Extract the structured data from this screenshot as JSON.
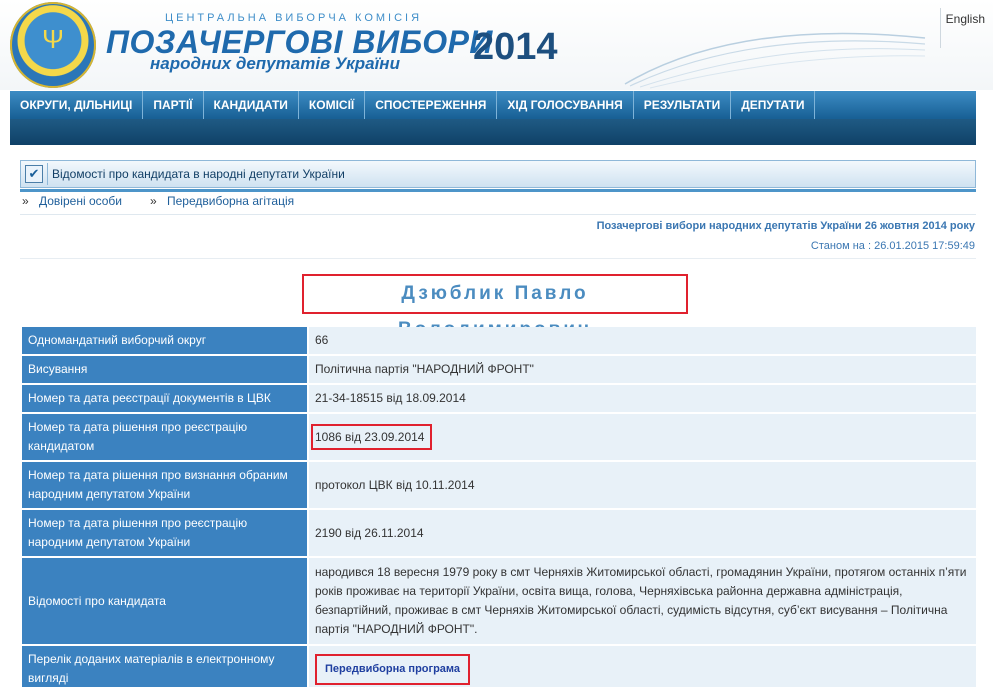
{
  "header": {
    "commission_name": "ЦЕНТРАЛЬНА ВИБОРЧА КОМІСІЯ",
    "title": "ПОЗАЧЕРГОВІ ВИБОРИ",
    "subtitle": "народних депутатів України",
    "year": "2014",
    "language_link": "English",
    "emblem_icon": "emblem-icon",
    "accent_color": "#1f6aad"
  },
  "nav": {
    "items": [
      "ОКРУГИ, ДІЛЬНИЦІ",
      "ПАРТІЇ",
      "КАНДИДАТИ",
      "КОМІСІЇ",
      "СПОСТЕРЕЖЕННЯ",
      "ХІД ГОЛОСУВАННЯ",
      "РЕЗУЛЬТАТИ",
      "ДЕПУТАТИ"
    ]
  },
  "section": {
    "title": "Відомості про кандидата в народні депутати України",
    "check_icon": "checkbox-icon",
    "links": [
      "Довірені особи",
      "Передвиборна агітація"
    ]
  },
  "meta": {
    "election": "Позачергові вибори народних депутатів України 26 жовтня 2014 року",
    "status": "Станом на : 26.01.2015 17:59:49"
  },
  "candidate": {
    "name": "Дзюблик Павло Володимирович"
  },
  "table": {
    "rows": [
      {
        "label": "Одномандатний виборчий округ",
        "value": "66"
      },
      {
        "label": "Висування",
        "value": "Політична партія \"НАРОДНИЙ ФРОНТ\""
      },
      {
        "label": "Номер та дата реєстрації документів в ЦВК",
        "value": "21-34-18515 від 18.09.2014"
      },
      {
        "label": "Номер та дата рішення про реєстрацію кандидатом",
        "value": "1086 від 23.09.2014"
      },
      {
        "label": "Номер та дата рішення про визнання обраним народним депутатом України",
        "value": "протокол ЦВК від 10.11.2014"
      },
      {
        "label": "Номер та дата рішення про реєстрацію народним депутатом України",
        "value": "2190 від 26.11.2014"
      },
      {
        "label": "Відомості про кандидата",
        "value": "народився 18 вересня 1979 року в смт Черняхів Житомирської області, громадянин України, протягом останніх п’яти років проживає на території України, освіта вища, голова, Черняхівська районна державна адміністрація, безпартійний, проживає в смт Черняхів Житомирської області, судимість відсутня, суб’єкт висування – Політична партія \"НАРОДНИЙ ФРОНТ\"."
      },
      {
        "label": "Перелік доданих матеріалів в електронному вигляді",
        "value": "Передвиборна програма"
      }
    ]
  }
}
